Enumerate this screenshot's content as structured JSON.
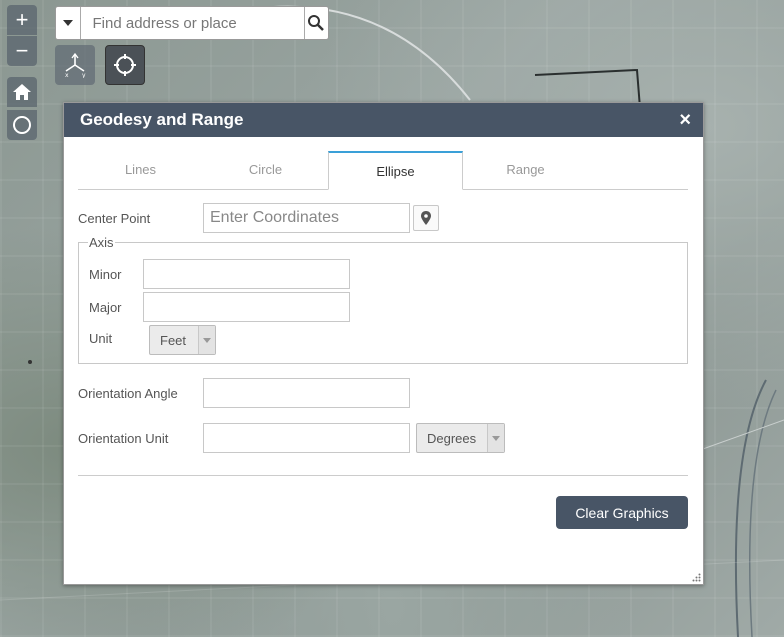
{
  "search": {
    "placeholder": "Find address or place",
    "dropdown_icon": "caret-down-icon",
    "search_icon": "search-icon"
  },
  "map_controls": {
    "zoom_in": "+",
    "zoom_out": "−",
    "home_icon": "home-icon",
    "locate_icon": "locate-icon"
  },
  "widget_buttons": {
    "geodesy_icon": "xyz-axis-icon",
    "coordinate_icon": "crosshair-icon"
  },
  "panel": {
    "title": "Geodesy and Range",
    "close": "×",
    "tabs": [
      {
        "label": "Lines",
        "active": false
      },
      {
        "label": "Circle",
        "active": false
      },
      {
        "label": "Ellipse",
        "active": true
      },
      {
        "label": "Range",
        "active": false
      }
    ],
    "center_point": {
      "label": "Center Point",
      "placeholder": "Enter Coordinates",
      "value": ""
    },
    "axis": {
      "legend": "Axis",
      "minor_label": "Minor",
      "minor_value": "",
      "major_label": "Major",
      "major_value": "",
      "unit_label": "Unit",
      "unit_value": "Feet"
    },
    "orientation_angle": {
      "label": "Orientation Angle",
      "value": ""
    },
    "orientation_unit": {
      "label": "Orientation Unit",
      "value": "",
      "unit_value": "Degrees"
    },
    "clear_button": "Clear Graphics"
  },
  "colors": {
    "header": "#485566",
    "active_tab_accent": "#3aa0d8",
    "button": "#485566"
  }
}
